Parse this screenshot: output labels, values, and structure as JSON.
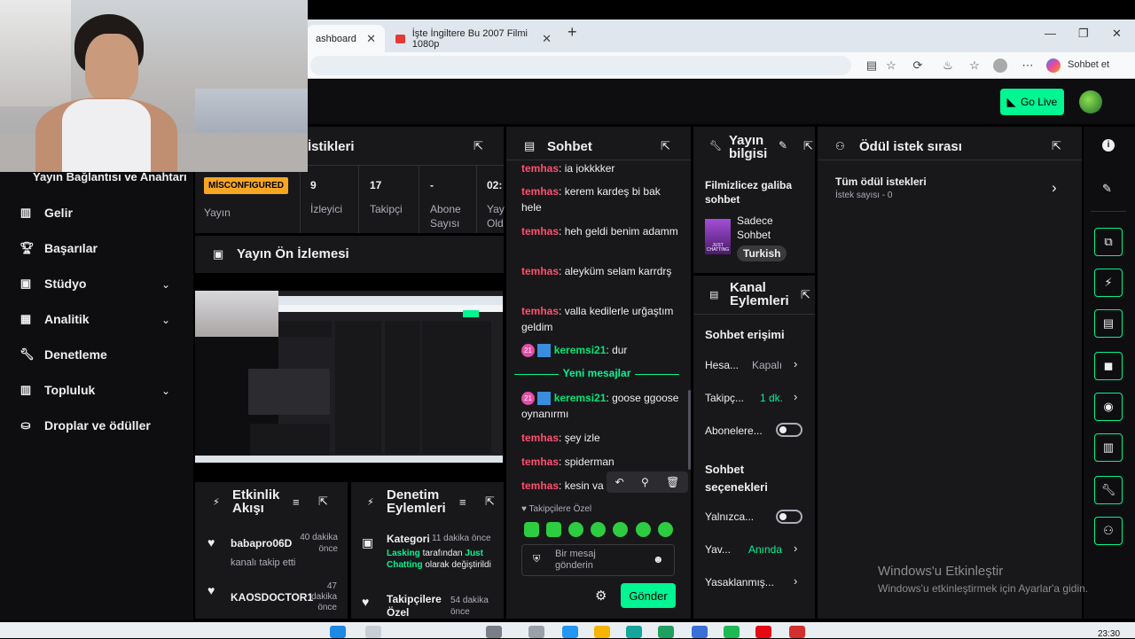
{
  "browser": {
    "tabs": [
      {
        "label": "ashboard"
      },
      {
        "label": "İşte İngiltere Bu 2007 Filmi 1080p"
      }
    ],
    "copilot_label": "Sohbet et"
  },
  "topbar": {
    "golive_label": "Go Live"
  },
  "sidebar": {
    "connection_label": "Yayın Bağlantısı ve Anahtarı",
    "items": [
      {
        "label": "Gelir"
      },
      {
        "label": "Başarılar"
      },
      {
        "label": "Stüdyo"
      },
      {
        "label": "Analitik"
      },
      {
        "label": "Denetleme"
      },
      {
        "label": "Topluluk"
      },
      {
        "label": "Droplar ve ödüller"
      }
    ]
  },
  "stats": {
    "title": "İstikleri",
    "status_badge": "MİSCONFIGURED",
    "status_label": "Yayın",
    "items": [
      {
        "value": "9",
        "label": "İzleyici"
      },
      {
        "value": "17",
        "label": "Takipçi"
      },
      {
        "value": "-",
        "label": "Abone Sayısı"
      },
      {
        "value": "02:",
        "label": "Yay Old"
      }
    ]
  },
  "preview": {
    "title": "Yayın Ön İzlemesi"
  },
  "activity": {
    "title": "Etkinlik Akışı",
    "items": [
      {
        "user": "babapro06D",
        "time": "40 dakika önce",
        "text": "kanalı takip etti"
      },
      {
        "user": "KAOSDOCTOR1",
        "time": "47 dakika önce",
        "text": ""
      }
    ]
  },
  "modactions": {
    "title": "Denetim Eylemleri",
    "items": [
      {
        "label": "Kategori",
        "time": "11 dakika önce",
        "actor": "Lasking",
        "mid": " tarafından ",
        "value": "Just Chatting",
        "tail": " olarak değiştirildi"
      },
      {
        "label": "Takipçilere Özel",
        "time": "54 dakika önce"
      }
    ]
  },
  "chat": {
    "title": "Sohbet",
    "messages": [
      {
        "user": "temhas",
        "text": ": ia jokkkker"
      },
      {
        "user": "temhas",
        "text": ": kerem kardeş bi bak hele"
      },
      {
        "user": "temhas",
        "text": ": heh geldi benim adamm"
      },
      {
        "user": "temhas",
        "text": ": aleyküm selam karrdrş"
      },
      {
        "user": "temhas",
        "text": ": valla kedilerle urğaştım geldim"
      },
      {
        "user": "keremsi21",
        "text": ": dur"
      },
      {
        "user": "keremsi21",
        "text": ": goose ggoose oynanırmı"
      },
      {
        "user": "temhas",
        "text": ": şey izle"
      },
      {
        "user": "temhas",
        "text": ": spiderman"
      },
      {
        "user": "temhas",
        "text": ": kesin va"
      }
    ],
    "new_messages_label": "Yeni mesajlar",
    "badge_number": "21",
    "followers_only_label": "Takipçilere Özel",
    "input_placeholder": "Bir mesaj gönderin",
    "send_label": "Gönder"
  },
  "streaminfo": {
    "title": "Yayın bilgisi",
    "stream_title": "Filmizlicez galiba sohbet",
    "category": "Sadece Sohbet",
    "category_art": "JUST CHATTING",
    "tag": "Turkish"
  },
  "channelactions": {
    "title": "Kanal Eylemleri",
    "chat_access_title": "Sohbet erişimi",
    "rows": [
      {
        "label": "Hesa...",
        "value": "Kapalı"
      },
      {
        "label": "Takipç...",
        "value": "1 dk."
      },
      {
        "label": "Abonelere...",
        "value": ""
      }
    ],
    "chat_options_title": "Sohbet seçenekleri",
    "option_rows": [
      {
        "label": "Yalnızca...",
        "value": ""
      },
      {
        "label": "Yav...",
        "value": "Anında"
      },
      {
        "label": "Yasaklanmış...",
        "value": ""
      }
    ]
  },
  "rewards": {
    "title": "Ödül istek sırası",
    "all_label": "Tüm ödül istekleri",
    "count_label": "İstek sayısı - 0"
  },
  "watermark": {
    "line1": "Windows'u Etkinleştir",
    "line2": "Windows'u etkinleştirmek için Ayarlar'a gidin."
  },
  "clock": "23:30",
  "colors": {
    "accent": "#00f593",
    "panel": "#18181b",
    "bg": "#0e0e10",
    "username_red": "#ff4f6d",
    "warning": "#f5a623"
  }
}
